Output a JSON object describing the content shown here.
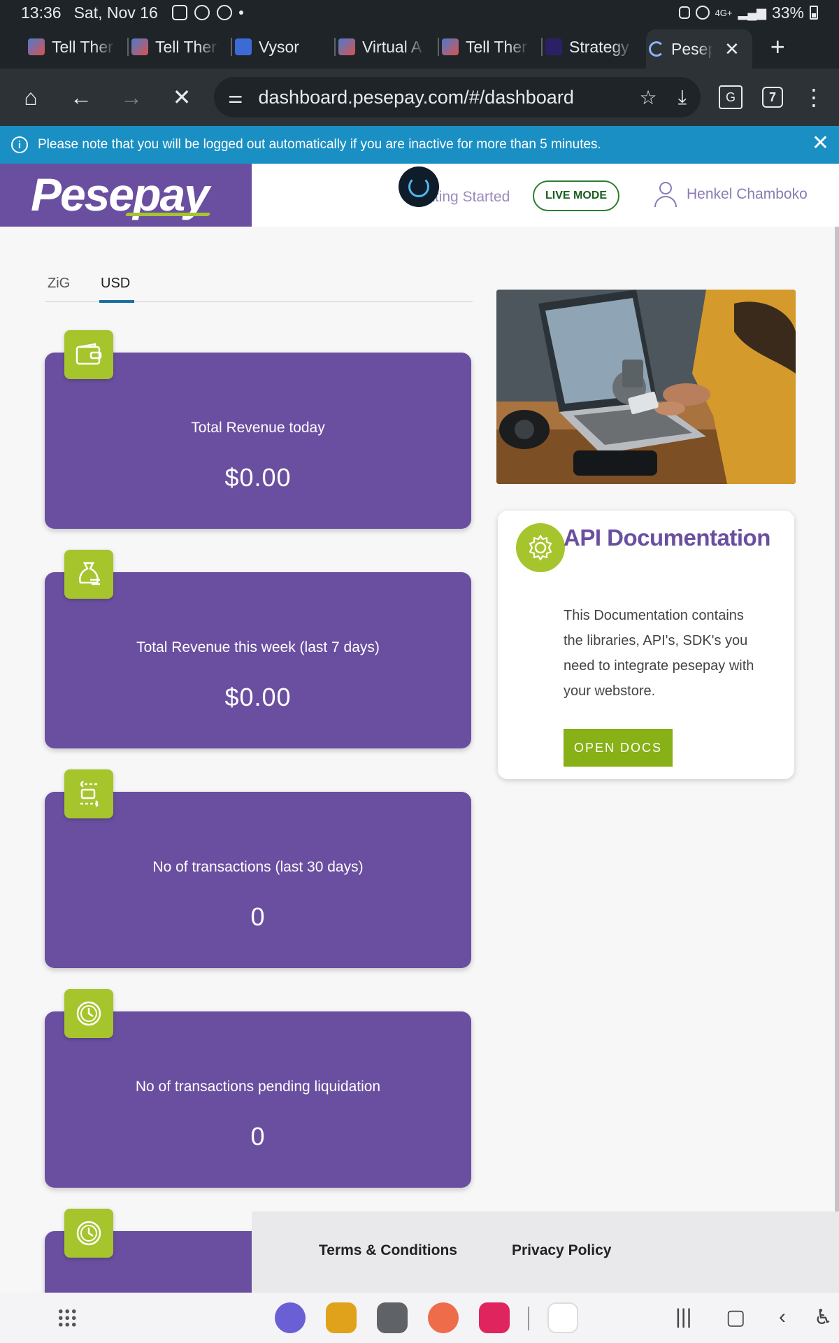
{
  "status_bar": {
    "time": "13:36",
    "date": "Sat, Nov 16",
    "network": "4G+",
    "battery": "33%"
  },
  "browser": {
    "tabs": [
      {
        "label": "Tell Ther",
        "favicon": "image-icon"
      },
      {
        "label": "Tell Ther",
        "favicon": "image-icon"
      },
      {
        "label": "Vysor",
        "favicon": "vysor-icon"
      },
      {
        "label": "Virtual A",
        "favicon": "image-icon"
      },
      {
        "label": "Tell Ther",
        "favicon": "image-icon"
      },
      {
        "label": "Strategy",
        "favicon": "strategy-icon"
      },
      {
        "label": "Pesep",
        "favicon": "loading-spinner-icon",
        "active": true
      }
    ],
    "new_tab": "+",
    "url": "dashboard.pesepay.com/#/dashboard",
    "tab_count": "7"
  },
  "notice": {
    "text": "Please note that you will be logged out automatically if you are inactive for more than 5 minutes."
  },
  "header": {
    "logo": "Pesepay",
    "getting_started": "Getting Started",
    "mode": "LIVE MODE",
    "user_name": "Henkel Chamboko"
  },
  "currency_tabs": [
    {
      "label": "ZiG",
      "selected": false
    },
    {
      "label": "USD",
      "selected": true
    }
  ],
  "stats": [
    {
      "title": "Total Revenue today",
      "value": "$0.00",
      "icon": "wallet-icon"
    },
    {
      "title": "Total Revenue this week (last 7 days)",
      "value": "$0.00",
      "icon": "money-bag-icon"
    },
    {
      "title": "No of transactions (last 30 days)",
      "value": "0",
      "icon": "transfer-icon"
    },
    {
      "title": "No of transactions pending liquidation",
      "value": "0",
      "icon": "clock-icon"
    },
    {
      "title": "",
      "value": "",
      "icon": "clock-icon"
    }
  ],
  "api_docs": {
    "title": "API Documentation",
    "body": "This Documentation contains the libraries, API's, SDK's you need to integrate pesepay with your webstore.",
    "button": "OPEN DOCS"
  },
  "footer": {
    "terms": "Terms & Conditions",
    "privacy": "Privacy Policy"
  },
  "colors": {
    "brand_purple": "#6a4fa0",
    "accent_green": "#a6c42c",
    "notice_blue": "#1a8fc4"
  }
}
